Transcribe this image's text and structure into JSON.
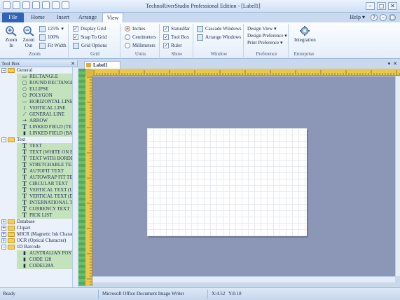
{
  "window": {
    "title": "TechnoRiverStudio Professional Edition - [Label1]",
    "minimize": "–",
    "maximize": "□",
    "close": "✕"
  },
  "tabs": {
    "file": "File",
    "home": "Home",
    "insert": "Insert",
    "arrange": "Arrange",
    "view": "View",
    "help": "Help ▾"
  },
  "ribbon": {
    "zoom": {
      "zoom_in": "Zoom In",
      "zoom_out": "Zoom Out",
      "percent": "125%",
      "hundred": "100%",
      "fit_width": "Fit Width",
      "label": "Zoom"
    },
    "grid": {
      "display_grid": "Display Grid",
      "snap_to_grid": "Snap To Grid",
      "grid_options": "Grid Options",
      "label": "Grid"
    },
    "units": {
      "inches": "Inches",
      "centimeters": "Centimeters",
      "millimeters": "Millimeters",
      "label": "Units"
    },
    "show": {
      "statusbar": "StatusBar",
      "toolbox": "Tool Box",
      "ruler": "Ruler",
      "label": "Show"
    },
    "window": {
      "cascade": "Cascade Windows",
      "arrange": "Arrange Windows",
      "label": "Window"
    },
    "preference": {
      "design_view": "Design View ▾",
      "design_pref": "Design Preference ▾",
      "print_pref": "Print Preference ▾",
      "label": "Preference"
    },
    "enterprise": {
      "integration": "Integration",
      "label": "Enterprise"
    }
  },
  "toolbox": {
    "title": "Tool Box",
    "items": [
      {
        "kind": "group",
        "exp": "−",
        "label": "General"
      },
      {
        "kind": "item",
        "icon": "▭",
        "label": "RECTANGLE"
      },
      {
        "kind": "item",
        "icon": "▢",
        "label": "ROUND RECTANGLE"
      },
      {
        "kind": "item",
        "icon": "○",
        "label": "ELLIPSE"
      },
      {
        "kind": "item",
        "icon": "⬠",
        "label": "POLYGON"
      },
      {
        "kind": "item",
        "icon": "—",
        "label": "HORIZONTAL LINE"
      },
      {
        "kind": "item",
        "icon": "/",
        "label": "VERTICAL LINE"
      },
      {
        "kind": "item",
        "icon": "⟋",
        "label": "GENERAL LINE"
      },
      {
        "kind": "item",
        "icon": "→",
        "label": "ARROW"
      },
      {
        "kind": "item",
        "icon": "T",
        "label": "LINKED FIELD (TEXT)"
      },
      {
        "kind": "item",
        "icon": "▮",
        "label": "LINKED FIELD (BARCODE)"
      },
      {
        "kind": "group",
        "exp": "−",
        "label": "Text"
      },
      {
        "kind": "item",
        "icon": "T",
        "label": "TEXT"
      },
      {
        "kind": "item",
        "icon": "T",
        "label": "TEXT (WHITE ON BLACK)"
      },
      {
        "kind": "item",
        "icon": "T",
        "label": "TEXT WITH BORDER"
      },
      {
        "kind": "item",
        "icon": "T",
        "label": "STRETCHABLE TEXT"
      },
      {
        "kind": "item",
        "icon": "T",
        "label": "AUTOFIT TEXT"
      },
      {
        "kind": "item",
        "icon": "T",
        "label": "AUTOWRAP FIT TEXT"
      },
      {
        "kind": "item",
        "icon": "T",
        "label": "CIRCULAR TEXT"
      },
      {
        "kind": "item",
        "icon": "T",
        "label": "VERTICAL TEXT (UP)"
      },
      {
        "kind": "item",
        "icon": "T",
        "label": "VERTICAL TEXT (DOWN)"
      },
      {
        "kind": "item",
        "icon": "T",
        "label": "INTERNATIONAL TEXT"
      },
      {
        "kind": "item",
        "icon": "T",
        "label": "CURRENCY TEXT"
      },
      {
        "kind": "item",
        "icon": "T",
        "label": "PICK LIST"
      },
      {
        "kind": "group",
        "exp": "+",
        "label": "Database"
      },
      {
        "kind": "group",
        "exp": "+",
        "label": "Clipart"
      },
      {
        "kind": "group",
        "exp": "+",
        "label": "MICR (Magnetic Ink Character)"
      },
      {
        "kind": "group",
        "exp": "+",
        "label": "OCR (Optical Character)"
      },
      {
        "kind": "group",
        "exp": "−",
        "label": "1D Barcode"
      },
      {
        "kind": "item",
        "icon": "▮",
        "label": "AUSTRALIAN POST"
      },
      {
        "kind": "item",
        "icon": "▮",
        "label": "CODE 128"
      },
      {
        "kind": "item",
        "icon": "▮",
        "label": "CODE128A"
      }
    ]
  },
  "document": {
    "tab": "Label1",
    "pin": "▾",
    "close": "✕"
  },
  "status": {
    "ready": "Ready",
    "printer": "Microsoft Office Document Image Writer",
    "x": "X:4.52",
    "y": "Y:0.18"
  },
  "colors": {
    "accent": "#2d63b8",
    "ruler": "#e8c74c",
    "canvas": "#8c97b8",
    "toolbox_green": "#c4e3bd"
  }
}
